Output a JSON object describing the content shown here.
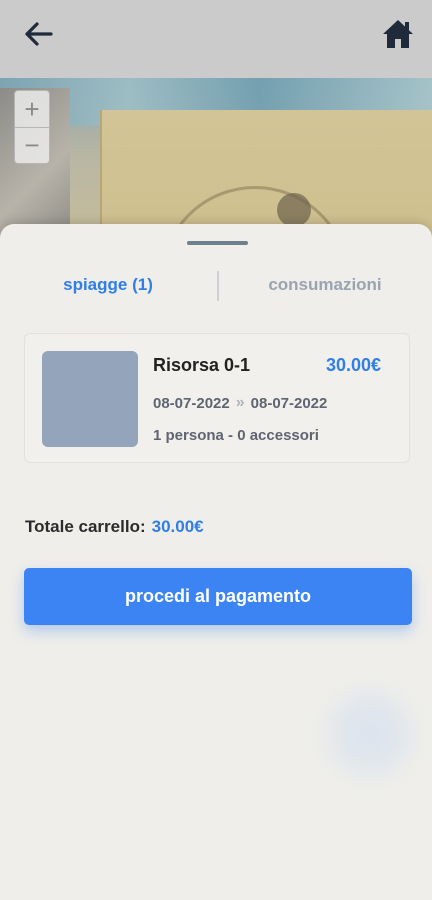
{
  "header": {
    "back_icon": "arrow-left-icon",
    "home_icon": "home-icon"
  },
  "map": {
    "zoom_in": "+",
    "zoom_out": "−"
  },
  "tabs": [
    {
      "label": "spiagge (1)",
      "active": true
    },
    {
      "label": "consumazioni",
      "active": false
    }
  ],
  "cart_item": {
    "name": "Risorsa 0-1",
    "price": "30.00€",
    "date_from": "08-07-2022",
    "date_to": "08-07-2022",
    "details": "1 persona - 0 accessori"
  },
  "total": {
    "label": "Totale carrello:",
    "amount": "30.00€"
  },
  "pay_button": {
    "label": "procedi al pagamento"
  },
  "colors": {
    "accent": "#3c84f3",
    "price": "#2f7fe6",
    "sheet": "#efeeea"
  }
}
